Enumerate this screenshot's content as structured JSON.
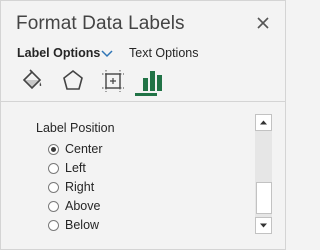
{
  "pane": {
    "title": "Format Data Labels",
    "close_icon": "close-icon"
  },
  "tabs": {
    "active_label": "Label Options",
    "inactive_label": "Text Options",
    "chevron_icon": "chevron-down-icon"
  },
  "icon_categories": [
    {
      "name": "fill-line-icon"
    },
    {
      "name": "effects-icon"
    },
    {
      "name": "size-properties-icon"
    },
    {
      "name": "label-options-icon",
      "selected": true
    }
  ],
  "label_position": {
    "title": "Label Position",
    "options": [
      {
        "label": "Center",
        "checked": true
      },
      {
        "label": "Left",
        "checked": false
      },
      {
        "label": "Right",
        "checked": false
      },
      {
        "label": "Above",
        "checked": false
      },
      {
        "label": "Below",
        "checked": false
      }
    ]
  },
  "colors": {
    "accent": "#217346",
    "icon_green": "#217346"
  }
}
